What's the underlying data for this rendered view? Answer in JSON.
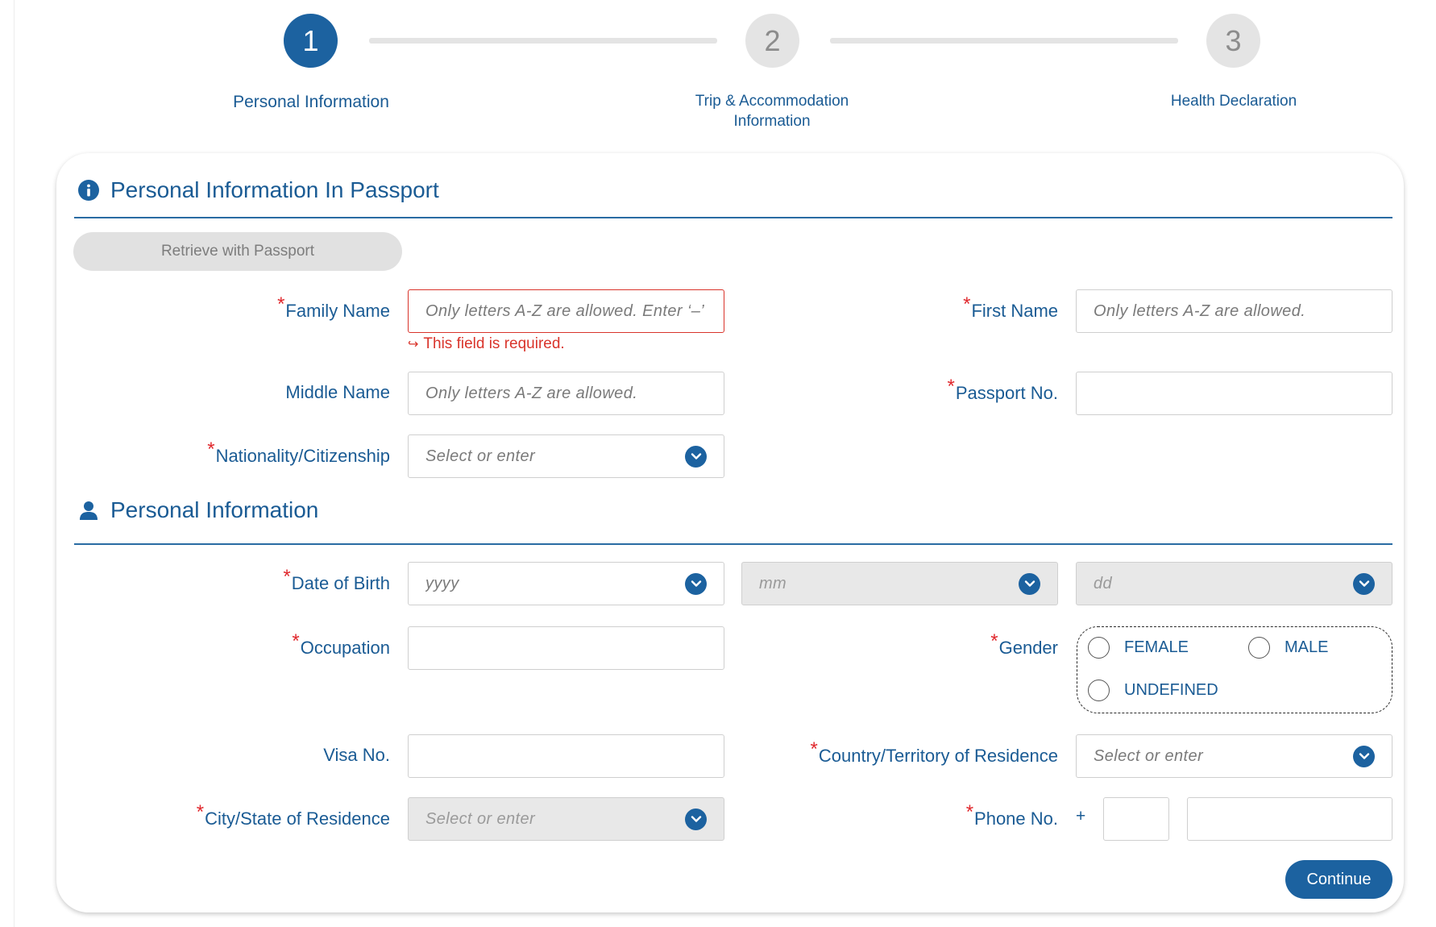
{
  "stepper": {
    "steps": [
      {
        "number": "1",
        "label": "Personal Information"
      },
      {
        "number": "2",
        "label_line1": "Trip & Accommodation",
        "label_line2": "Information"
      },
      {
        "number": "3",
        "label": "Health Declaration"
      }
    ]
  },
  "passport_section": {
    "title": "Personal Information In Passport",
    "icon": "info-icon",
    "retrieve_button": "Retrieve with Passport",
    "family_name": {
      "label": "Family Name",
      "placeholder": "Only letters A-Z are allowed. Enter ‘–’",
      "error": "This field is required."
    },
    "first_name": {
      "label": "First Name",
      "placeholder": "Only letters A-Z are allowed."
    },
    "middle_name": {
      "label": "Middle Name",
      "placeholder": "Only letters A-Z are allowed."
    },
    "passport_no": {
      "label": "Passport No.",
      "placeholder": ""
    },
    "nationality": {
      "label": "Nationality/Citizenship",
      "placeholder": "Select or enter"
    }
  },
  "personal_section": {
    "title": "Personal Information",
    "icon": "person-icon",
    "dob": {
      "label": "Date of Birth",
      "year_placeholder": "yyyy",
      "month_placeholder": "mm",
      "day_placeholder": "dd"
    },
    "occupation": {
      "label": "Occupation"
    },
    "gender": {
      "label": "Gender",
      "options": [
        "FEMALE",
        "MALE",
        "UNDEFINED"
      ]
    },
    "visa_no": {
      "label": "Visa No."
    },
    "country_residence": {
      "label": "Country/Territory of Residence",
      "placeholder": "Select or enter"
    },
    "city_residence": {
      "label": "City/State of Residence",
      "placeholder": "Select or enter"
    },
    "phone_no": {
      "label": "Phone No.",
      "prefix": "+"
    }
  },
  "continue_button": "Continue",
  "colors": {
    "primary": "#1c62a0",
    "error": "#d9342b",
    "disabled": "#e8e8e8"
  }
}
